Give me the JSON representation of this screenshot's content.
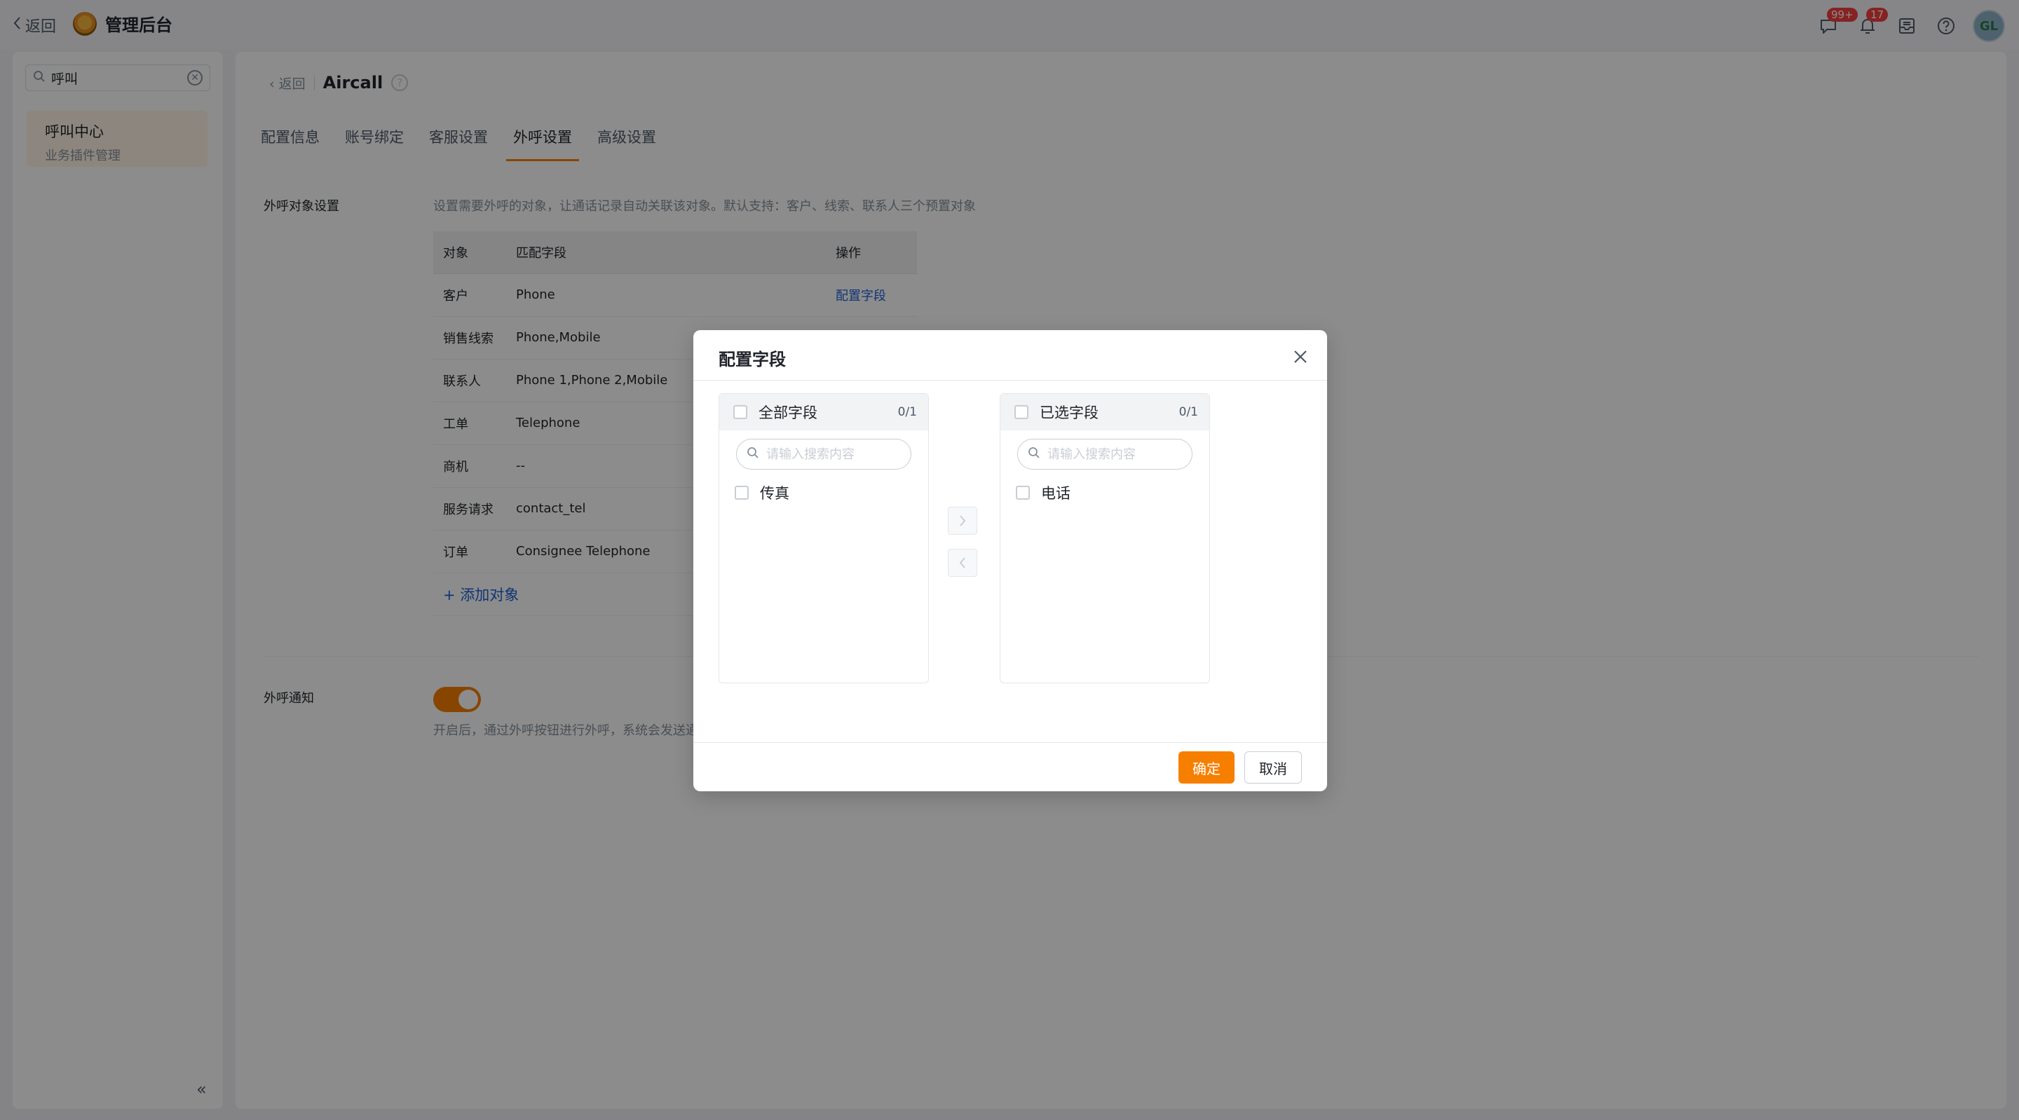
{
  "topbar": {
    "back_label": "返回",
    "title": "管理后台",
    "icons": [
      {
        "name": "message-icon",
        "badge": "99+"
      },
      {
        "name": "bell-icon",
        "badge": "17"
      },
      {
        "name": "inbox-icon",
        "badge": ""
      },
      {
        "name": "help-icon",
        "badge": ""
      }
    ],
    "avatar_initials": "GL"
  },
  "sidebar": {
    "search_value": "呼叫",
    "items": [
      {
        "title": "呼叫中心",
        "subtitle": "业务插件管理"
      }
    ]
  },
  "main": {
    "back_label": "返回",
    "title": "Aircall",
    "tabs": [
      "配置信息",
      "账号绑定",
      "客服设置",
      "外呼设置",
      "高级设置"
    ],
    "active_tab": "外呼设置",
    "outbound_object": {
      "label": "外呼对象设置",
      "description": "设置需要外呼的对象，让通话记录自动关联该对象。默认支持：客户、线索、联系人三个预置对象",
      "columns": [
        "对象",
        "匹配字段",
        "操作"
      ],
      "rows": [
        {
          "object": "客户",
          "field": "Phone",
          "action": "配置字段"
        },
        {
          "object": "销售线索",
          "field": "Phone,Mobile",
          "action": ""
        },
        {
          "object": "联系人",
          "field": "Phone 1,Phone 2,Mobile",
          "action": ""
        },
        {
          "object": "工单",
          "field": "Telephone",
          "action": ""
        },
        {
          "object": "商机",
          "field": "--",
          "action": ""
        },
        {
          "object": "服务请求",
          "field": "contact_tel",
          "action": ""
        },
        {
          "object": "订单",
          "field": "Consignee Telephone",
          "action": ""
        }
      ],
      "add_label": "+ 添加对象"
    },
    "outbound_notice": {
      "label": "外呼通知",
      "enabled": true,
      "description": "开启后，通过外呼按钮进行外呼，系统会发送通"
    }
  },
  "modal": {
    "title": "配置字段",
    "left_panel": {
      "title": "全部字段",
      "count": "0/1",
      "search_placeholder": "请输入搜索内容",
      "items": [
        "传真"
      ]
    },
    "right_panel": {
      "title": "已选字段",
      "count": "0/1",
      "search_placeholder": "请输入搜索内容",
      "items": [
        "电话"
      ]
    },
    "ok_label": "确定",
    "cancel_label": "取消"
  },
  "colors": {
    "accent": "#f77f00",
    "link": "#1d5fd6",
    "badge": "#f53f3f"
  }
}
